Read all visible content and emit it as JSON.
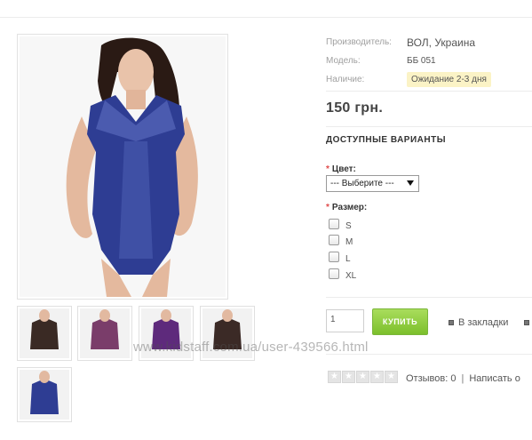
{
  "product": {
    "manufacturer_label": "Производитель:",
    "manufacturer_value": "ВОЛ, Украина",
    "model_label": "Модель:",
    "model_value": "ББ 051",
    "stock_label": "Наличие:",
    "stock_value": "Ожидание 2-3 дня",
    "price": "150 грн."
  },
  "options": {
    "title": "ДОСТУПНЫЕ ВАРИАНТЫ",
    "color_label": "Цвет:",
    "color_select_value": "--- Выберите ---",
    "size_label": "Размер:",
    "sizes": [
      "S",
      "M",
      "L",
      "XL"
    ]
  },
  "cart": {
    "quantity": "1",
    "buy_label": "КУПИТЬ",
    "wishlist_label": "В закладки"
  },
  "reviews": {
    "count_text": "Отзывов: 0",
    "separator": "|",
    "write_text": "Написать о"
  },
  "watermark": "www.kidstaff.com.ua/user-439566.html",
  "icons": {
    "star": "star-empty-icon",
    "wishlist": "bookmark-square-icon"
  },
  "colors": {
    "buy_button": "#8ccc3a",
    "stock_badge": "#fbf3c6",
    "required": "#e04a4a",
    "garment": "#2e3d93"
  }
}
